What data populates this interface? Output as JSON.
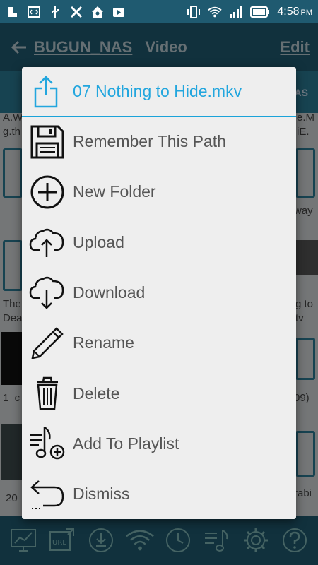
{
  "status_bar": {
    "time": "4:58",
    "ampm": "PM",
    "left_icons": [
      "app-icon",
      "code-icon",
      "usb-icon",
      "x-app-icon",
      "home-app-icon",
      "play-icon"
    ],
    "right_icons": [
      "vibrate-icon",
      "wifi-icon",
      "signal-icon",
      "battery-icon"
    ]
  },
  "app_bar": {
    "back_icon": "arrow-left-icon",
    "breadcrumb": "BUGUN_NAS",
    "section": "Video",
    "edit_label": "Edit"
  },
  "background": {
    "tab_label": "AS",
    "text_a_left": "A.W",
    "text_b_left": "g.th",
    "text_a_right": "e.M",
    "text_b_right": "iE.",
    "row1_right": "way",
    "row2_left_a": "The",
    "row2_left_b": "Dea",
    "row2_right_a": "g to",
    "row2_right_b": "tv",
    "row3_left": "1_c",
    "row3_right": "09)",
    "row4_left": "20",
    "row4_right": "rabi"
  },
  "menu": {
    "header_icon": "share-icon",
    "title": "07 Nothing to Hide.mkv",
    "items": [
      {
        "icon": "floppy-disk-icon",
        "label": "Remember This Path"
      },
      {
        "icon": "plus-circle-icon",
        "label": "New Folder"
      },
      {
        "icon": "cloud-upload-icon",
        "label": "Upload"
      },
      {
        "icon": "cloud-download-icon",
        "label": "Download"
      },
      {
        "icon": "pencil-icon",
        "label": "Rename"
      },
      {
        "icon": "trash-icon",
        "label": "Delete"
      },
      {
        "icon": "playlist-add-icon",
        "label": "Add To Playlist"
      },
      {
        "icon": "undo-arrow-icon",
        "label": "Dismiss"
      }
    ]
  },
  "bottom_nav": {
    "icons": [
      "network-chart-icon",
      "url-icon",
      "download-circle-icon",
      "wifi-cast-icon",
      "clock-icon",
      "playlist-icon",
      "settings-gear-icon",
      "help-icon"
    ]
  },
  "colors": {
    "primary_dark": "#1f5a70",
    "accent": "#22a6de",
    "menu_bg": "#eeeeee",
    "menu_text": "#555555"
  }
}
